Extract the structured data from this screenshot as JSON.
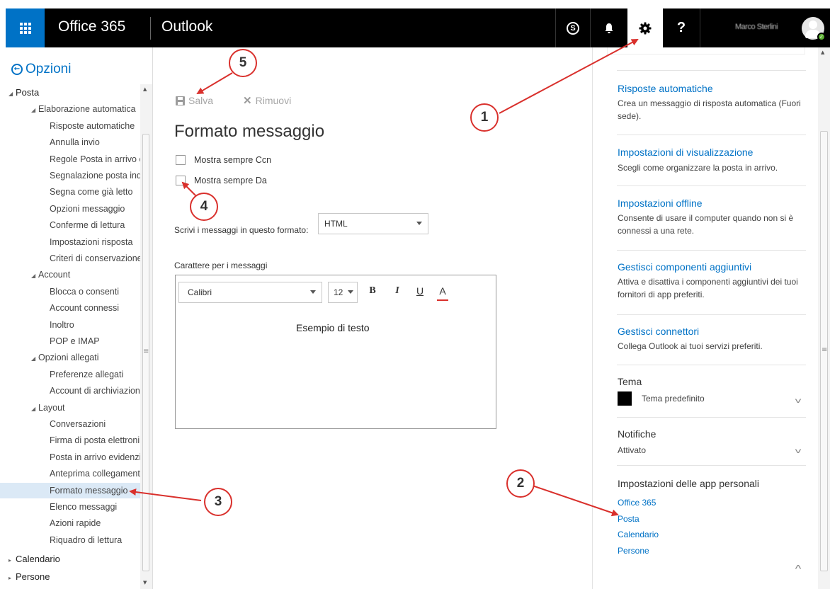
{
  "topbar": {
    "suite": "Office 365",
    "app": "Outlook",
    "skype_glyph": "S",
    "help_glyph": "?",
    "user_name": "Marco Sterlini",
    "icons": [
      "waffle-icon",
      "skype-icon",
      "bell-icon",
      "gear-icon",
      "help-icon",
      "avatar-icon"
    ]
  },
  "leftnav": {
    "back_label": "Opzioni",
    "items": [
      {
        "label": "Posta",
        "level": 0,
        "expanded": true
      },
      {
        "label": "Elaborazione automatica",
        "level": 1,
        "expanded": true
      },
      {
        "label": "Risposte automatiche",
        "level": 2
      },
      {
        "label": "Annulla invio",
        "level": 2
      },
      {
        "label": "Regole Posta in arrivo e",
        "level": 2
      },
      {
        "label": "Segnalazione posta ind",
        "level": 2
      },
      {
        "label": "Segna come già letto",
        "level": 2
      },
      {
        "label": "Opzioni messaggio",
        "level": 2
      },
      {
        "label": "Conferme di lettura",
        "level": 2
      },
      {
        "label": "Impostazioni risposta",
        "level": 2
      },
      {
        "label": "Criteri di conservazione",
        "level": 2
      },
      {
        "label": "Account",
        "level": 1,
        "expanded": true
      },
      {
        "label": "Blocca o consenti",
        "level": 2
      },
      {
        "label": "Account connessi",
        "level": 2
      },
      {
        "label": "Inoltro",
        "level": 2
      },
      {
        "label": "POP e IMAP",
        "level": 2
      },
      {
        "label": "Opzioni allegati",
        "level": 1,
        "expanded": true
      },
      {
        "label": "Preferenze allegati",
        "level": 2
      },
      {
        "label": "Account di archiviazion",
        "level": 2
      },
      {
        "label": "Layout",
        "level": 1,
        "expanded": true
      },
      {
        "label": "Conversazioni",
        "level": 2
      },
      {
        "label": "Firma di posta elettroni",
        "level": 2
      },
      {
        "label": "Posta in arrivo evidenzi",
        "level": 2
      },
      {
        "label": "Anteprima collegament",
        "level": 2
      },
      {
        "label": "Formato messaggio",
        "level": 2,
        "selected": true
      },
      {
        "label": "Elenco messaggi",
        "level": 2
      },
      {
        "label": "Azioni rapide",
        "level": 2
      },
      {
        "label": "Riquadro di lettura",
        "level": 2
      },
      {
        "label": "Calendario",
        "level": 0,
        "expanded": false
      },
      {
        "label": "Persone",
        "level": 0,
        "expanded": false
      }
    ]
  },
  "main": {
    "save_label": "Salva",
    "remove_label": "Rimuovi",
    "title": "Formato messaggio",
    "checkbox_bcc": "Mostra sempre Ccn",
    "checkbox_from": "Mostra sempre Da",
    "format_label": "Scrivi i messaggi in questo formato:",
    "format_value": "HTML",
    "font_label": "Carattere per i messaggi",
    "font_value": "Calibri",
    "size_value": "12",
    "bold": "B",
    "italic": "I",
    "underline": "U",
    "color": "A",
    "sample_text": "Esempio di testo"
  },
  "rightpane": {
    "links": [
      {
        "title": "Risposte automatiche",
        "desc": "Crea un messaggio di risposta automatica (Fuori sede)."
      },
      {
        "title": "Impostazioni di visualizzazione",
        "desc": "Scegli come organizzare la posta in arrivo."
      },
      {
        "title": "Impostazioni offline",
        "desc": "Consente di usare il computer quando non si è connessi a una rete."
      },
      {
        "title": "Gestisci componenti aggiuntivi",
        "desc": "Attiva e disattiva i componenti aggiuntivi dei tuoi fornitori di app preferiti."
      },
      {
        "title": "Gestisci connettori",
        "desc": "Collega Outlook ai tuoi servizi preferiti."
      }
    ],
    "theme_title": "Tema",
    "theme_value": "Tema predefinito",
    "notif_title": "Notifiche",
    "notif_value": "Attivato",
    "apps_title": "Impostazioni delle app personali",
    "apps": [
      "Office 365",
      "Posta",
      "Calendario",
      "Persone"
    ]
  },
  "annotations": {
    "b1": "1",
    "b2": "2",
    "b3": "3",
    "b4": "4",
    "b5": "5",
    "color": "#d9302c"
  },
  "colors": {
    "accent": "#0072c6",
    "topbar": "#000000",
    "selected_bg": "#dbe9f6"
  }
}
